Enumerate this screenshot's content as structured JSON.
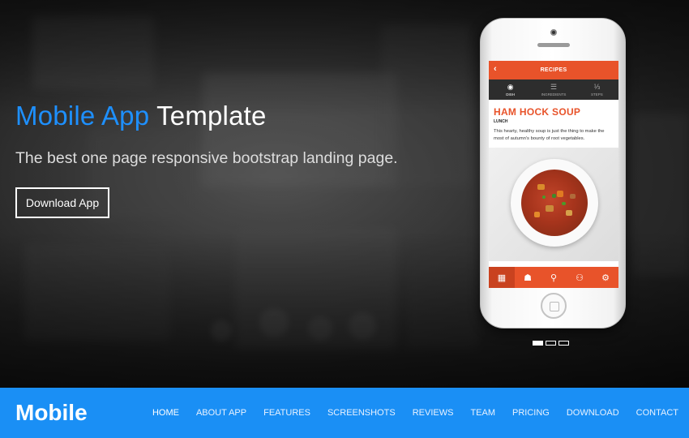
{
  "hero": {
    "title_accent": "Mobile App",
    "title_rest": "Template",
    "subtitle": "The best one page responsive bootstrap landing page.",
    "cta_label": "Download App"
  },
  "phone_app": {
    "header_title": "RECIPES",
    "back_glyph": "‹",
    "tabs": [
      {
        "label": "DISH",
        "icon": "dish-icon",
        "glyph": "◉",
        "active": true
      },
      {
        "label": "INGREDIENTS",
        "icon": "list-icon",
        "glyph": "☰",
        "active": false
      },
      {
        "label": "STEPS",
        "icon": "steps-icon",
        "glyph": "⅓",
        "active": false
      }
    ],
    "recipe_title": "HAM HOCK SOUP",
    "recipe_tag": "LUNCH",
    "recipe_desc": "This hearty, healthy soup is just the thing to make the most of autumn's bounty of root vegetables.",
    "bottom_nav": [
      {
        "icon": "grid-icon",
        "glyph": "▦",
        "active": true
      },
      {
        "icon": "chef-hat-icon",
        "glyph": "☗",
        "active": false
      },
      {
        "icon": "cutlery-icon",
        "glyph": "⚲",
        "active": false
      },
      {
        "icon": "users-icon",
        "glyph": "⚇",
        "active": false
      },
      {
        "icon": "gear-icon",
        "glyph": "⚙",
        "active": false
      }
    ],
    "accent_color": "#e8532a"
  },
  "slider": {
    "count": 3,
    "active_index": 0
  },
  "navbar": {
    "brand": "Mobile",
    "items": [
      "HOME",
      "ABOUT APP",
      "FEATURES",
      "SCREENSHOTS",
      "REVIEWS",
      "TEAM",
      "PRICING",
      "DOWNLOAD",
      "CONTACT"
    ],
    "active": "HOME",
    "color": "#1a8ff5"
  }
}
